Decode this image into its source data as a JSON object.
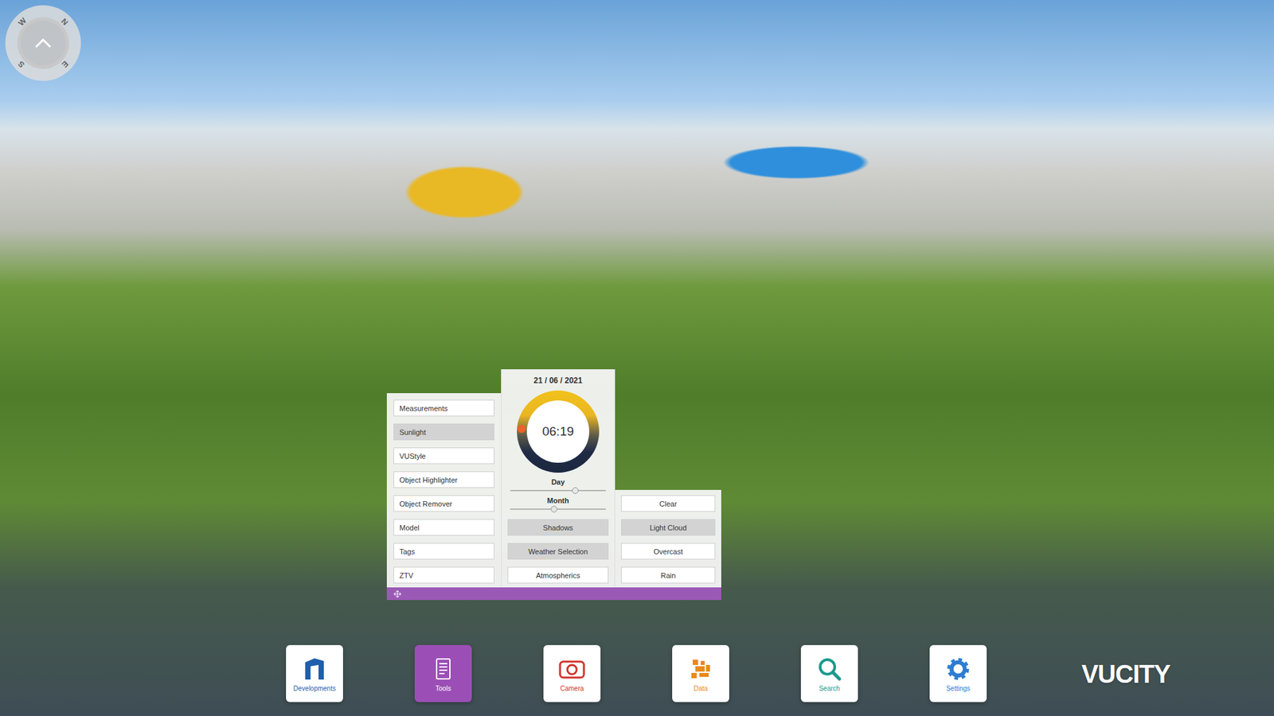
{
  "compass": {
    "letters": [
      {
        "text": "W",
        "pos": "nw"
      },
      {
        "text": "N",
        "pos": "ne"
      },
      {
        "text": "S",
        "pos": "sw"
      },
      {
        "text": "E",
        "pos": "se"
      }
    ]
  },
  "tools_menu": [
    {
      "label": "Measurements",
      "selected": false
    },
    {
      "label": "Sunlight",
      "selected": true
    },
    {
      "label": "VUStyle",
      "selected": false
    },
    {
      "label": "Object Highlighter",
      "selected": false
    },
    {
      "label": "Object Remover",
      "selected": false
    },
    {
      "label": "Model",
      "selected": false
    },
    {
      "label": "Tags",
      "selected": false
    },
    {
      "label": "ZTV",
      "selected": false
    }
  ],
  "sunlight": {
    "date": "21 / 06 / 2021",
    "time": "06:19",
    "time_level": 0.263,
    "sliders": [
      {
        "label": "Day",
        "level": 0.68
      },
      {
        "label": "Month",
        "level": 0.46
      }
    ],
    "toggles": [
      {
        "label": "Shadows",
        "selected": true
      },
      {
        "label": "Weather Selection",
        "selected": true
      },
      {
        "label": "Atmospherics",
        "selected": false
      }
    ]
  },
  "weather": [
    {
      "label": "Clear",
      "selected": false
    },
    {
      "label": "Light Cloud",
      "selected": true
    },
    {
      "label": "Overcast",
      "selected": false
    },
    {
      "label": "Rain",
      "selected": false
    }
  ],
  "dock": [
    {
      "label": "Developments",
      "icon": "developments",
      "selected": false,
      "color": "#1f5fae"
    },
    {
      "label": "Tools",
      "icon": "tools",
      "selected": true,
      "color": "#ffffff"
    },
    {
      "label": "Camera",
      "icon": "camera",
      "selected": false,
      "color": "#d0342c"
    },
    {
      "label": "Data",
      "icon": "data",
      "selected": false,
      "color": "#e98a1c"
    },
    {
      "label": "Search",
      "icon": "search",
      "selected": false,
      "color": "#1a9a8c"
    },
    {
      "label": "Settings",
      "icon": "settings",
      "selected": false,
      "color": "#2d7dd2"
    }
  ],
  "logo": "VUCITY"
}
